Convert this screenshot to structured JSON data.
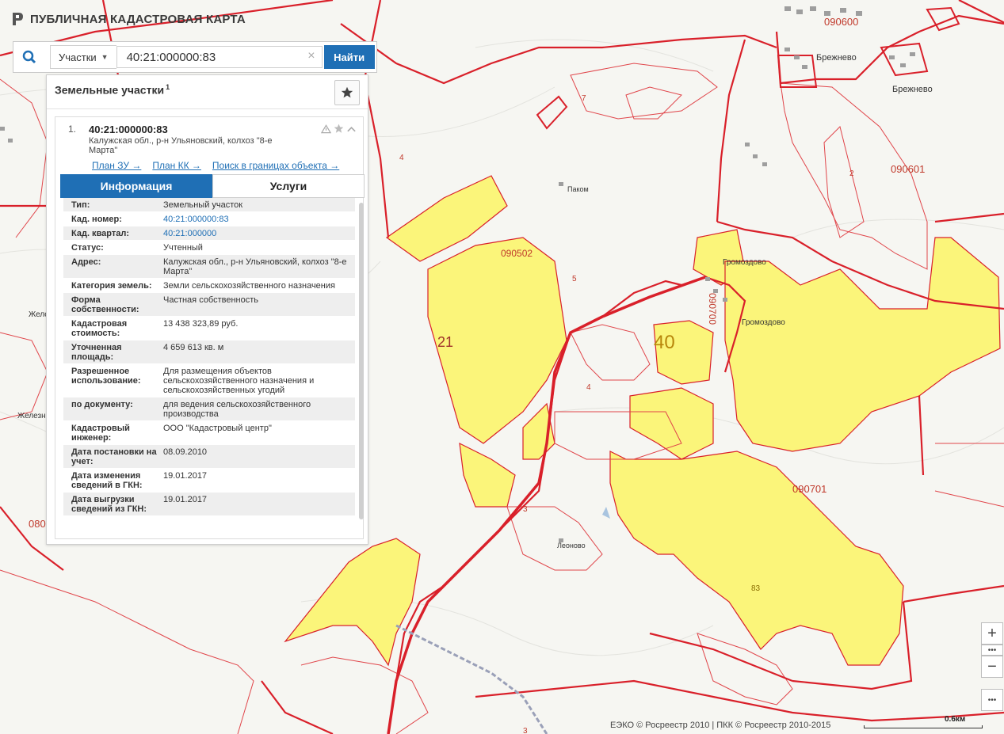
{
  "header": {
    "title": "ПУБЛИЧНАЯ КАДАСТРОВАЯ КАРТА"
  },
  "search": {
    "type_label": "Участки",
    "query": "40:21:000000:83",
    "button_label": "Найти"
  },
  "panel": {
    "title": "Земельные участки",
    "title_sup": "1",
    "result": {
      "number": "1.",
      "cad_number": "40:21:000000:83",
      "address": "Калужская обл., р-н Ульяновский, колхоз \"8-е Марта\"",
      "links": [
        "План ЗУ →",
        "План КК →",
        "Поиск в границах объекта →"
      ],
      "tabs": [
        "Информация",
        "Услуги"
      ],
      "rows": [
        {
          "label": "Тип:",
          "value": "Земельный участок"
        },
        {
          "label": "Кад. номер:",
          "value": "40:21:000000:83",
          "link": true
        },
        {
          "label": "Кад. квартал:",
          "value": "40:21:000000",
          "link": true
        },
        {
          "label": "Статус:",
          "value": "Учтенный"
        },
        {
          "label": "Адрес:",
          "value": "Калужская обл., р-н Ульяновский, колхоз \"8-е Марта\""
        },
        {
          "label": "Категория земель:",
          "value": "Земли сельскохозяйственного назначения"
        },
        {
          "label": "Форма собственности:",
          "value": "Частная собственность"
        },
        {
          "label": "Кадастровая стоимость:",
          "value": "13 438 323,89 руб."
        },
        {
          "label": "Уточненная площадь:",
          "value": "4 659 613 кв. м"
        },
        {
          "label": "Разрешенное использование:",
          "value": "Для размещения объектов сельскохозяйственного назначения и сельскохозяйственных угодий"
        },
        {
          "label": "по документу:",
          "value": "для ведения сельскохозяйственного производства"
        },
        {
          "label": "Кадастровый инженер:",
          "value": "ООО \"Кадастровый центр\""
        },
        {
          "label": "Дата постановки на учет:",
          "value": "08.09.2010"
        },
        {
          "label": "Дата изменения сведений в ГКН:",
          "value": "19.01.2017"
        },
        {
          "label": "Дата выгрузки сведений из ГКН:",
          "value": "19.01.2017"
        }
      ]
    }
  },
  "map_labels": {
    "q090600": "090600",
    "q090601": "090601",
    "q090502": "090502",
    "q090701": "090701",
    "q090700": "090700",
    "q080": "080",
    "n40": "40",
    "n21": "21",
    "n83": "83",
    "n7": "7",
    "n4a": "4",
    "n4b": "4",
    "n2": "2",
    "n5": "5",
    "n3a": "3",
    "n3b": "3",
    "village_brezhnevo1": "Брежнево",
    "village_brezhnevo2": "Брежнево",
    "village_gromozdovo1": "Громоздово",
    "village_gromozdovo2": "Громоздово",
    "village_pakom": "Паком",
    "village_leonovo": "Леоново",
    "place_zhelez1": "Желе",
    "place_zhelez2": "Железн"
  },
  "controls": {
    "zoom_in": "+",
    "zoom_out": "−",
    "more": "•••"
  },
  "footer": {
    "attribution": "ЕЭКО © Росреестр 2010 | ПКК © Росреестр 2010-2015",
    "scale": "0.6км"
  },
  "colors": {
    "accent": "#1f6fb5",
    "parcel_fill": "#fbf57a",
    "boundary_red": "#d9202a"
  }
}
